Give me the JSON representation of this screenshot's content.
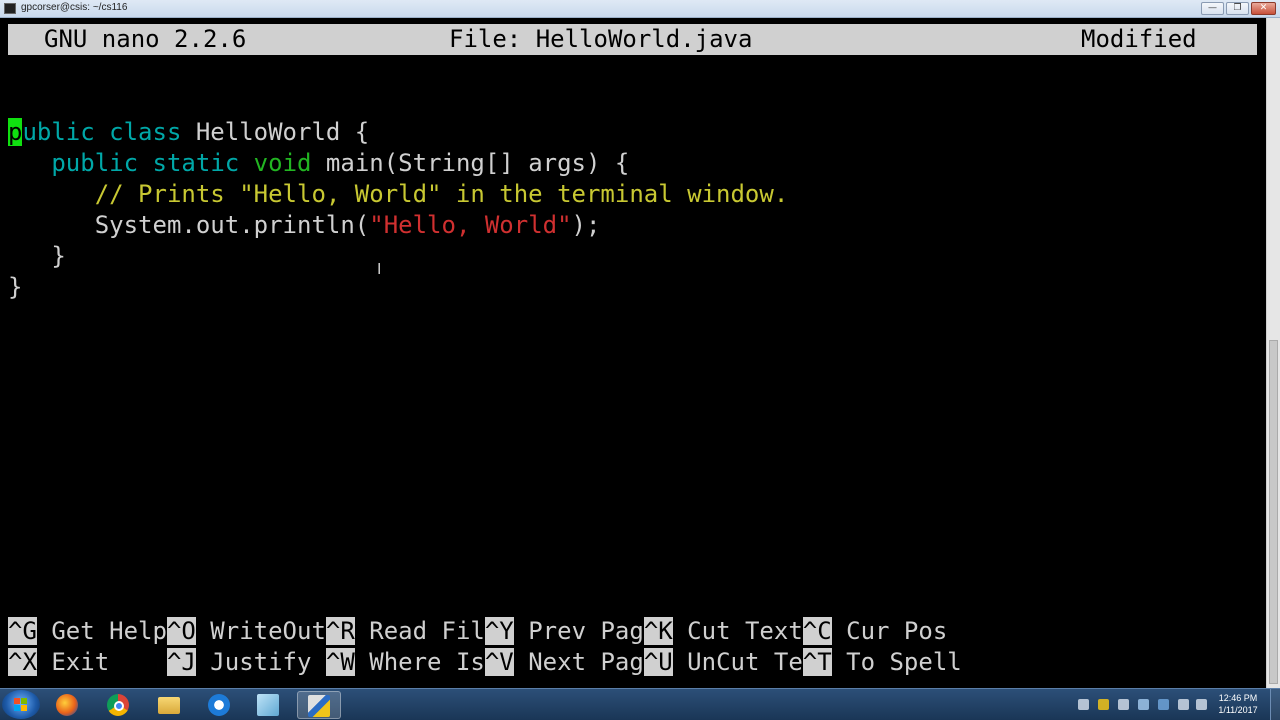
{
  "window": {
    "title": "gpcorser@csis: ~/cs116",
    "min_label": "—",
    "max_label": "❐",
    "close_label": "✕"
  },
  "nano": {
    "app": "GNU nano 2.2.6",
    "file": "File: HelloWorld.java",
    "status": "Modified"
  },
  "code": {
    "l1_cursor": "p",
    "l1_kw1": "ublic",
    "l1_kw2": "class",
    "l1_rest": " HelloWorld {",
    "l2_kw1": "public",
    "l2_kw2": "static",
    "l2_ty": "void",
    "l2_rest": " main(String[] args) {",
    "l3_comment": "// Prints \"Hello, World\" in the terminal window.",
    "l4_pre": "System.out.println(",
    "l4_str": "\"Hello, World\"",
    "l4_post": ");",
    "l5": "}",
    "l6": "}"
  },
  "shortcuts": {
    "row1": [
      {
        "key": "^G",
        "label": " Get Help"
      },
      {
        "key": "^O",
        "label": " WriteOut"
      },
      {
        "key": "^R",
        "label": " Read Fil"
      },
      {
        "key": "^Y",
        "label": " Prev Pag"
      },
      {
        "key": "^K",
        "label": " Cut Text"
      },
      {
        "key": "^C",
        "label": " Cur Pos"
      }
    ],
    "row2": [
      {
        "key": "^X",
        "label": " Exit    "
      },
      {
        "key": "^J",
        "label": " Justify "
      },
      {
        "key": "^W",
        "label": " Where Is"
      },
      {
        "key": "^V",
        "label": " Next Pag"
      },
      {
        "key": "^U",
        "label": " UnCut Te"
      },
      {
        "key": "^T",
        "label": " To Spell"
      }
    ]
  },
  "taskbar": {
    "time": "12:46 PM",
    "date": "1/11/2017",
    "icons": [
      "start-orb-icon",
      "firefox-icon",
      "chrome-icon",
      "file-explorer-icon",
      "refresh-app-icon",
      "notepad-icon",
      "putty-icon"
    ]
  },
  "colors": {
    "keyword": "#00a8a8",
    "type": "#22b522",
    "comment": "#c8c832",
    "string": "#d03030",
    "cursor": "#10e010",
    "text": "#d0d0d0",
    "bar": "#d0d0d0"
  }
}
